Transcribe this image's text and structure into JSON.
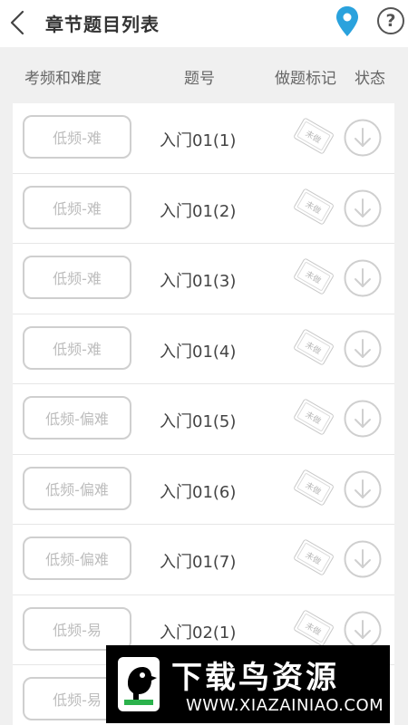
{
  "header": {
    "title": "章节题目列表",
    "back_icon": "back-chevron-icon",
    "location_icon": "location-pin-icon",
    "help_label": "?"
  },
  "columns": {
    "frequency_difficulty": "考频和难度",
    "question_number": "题号",
    "mark": "做题标记",
    "status": "状态"
  },
  "rows": [
    {
      "badge": "低频-难",
      "label": "入门01(1)",
      "mark": "未做"
    },
    {
      "badge": "低频-难",
      "label": "入门01(2)",
      "mark": "未做"
    },
    {
      "badge": "低频-难",
      "label": "入门01(3)",
      "mark": "未做"
    },
    {
      "badge": "低频-难",
      "label": "入门01(4)",
      "mark": "未做"
    },
    {
      "badge": "低频-偏难",
      "label": "入门01(5)",
      "mark": "未做"
    },
    {
      "badge": "低频-偏难",
      "label": "入门01(6)",
      "mark": "未做"
    },
    {
      "badge": "低频-偏难",
      "label": "入门01(7)",
      "mark": "未做"
    },
    {
      "badge": "低频-易",
      "label": "入门02(1)",
      "mark": "未做"
    },
    {
      "badge": "低频-易",
      "label": "",
      "mark": ""
    }
  ],
  "watermark": {
    "title": "下载鸟资源",
    "url": "WWW.XIAZAINIAO.COM"
  },
  "colors": {
    "accent_blue": "#2aa2dd",
    "badge_border": "#cfcfcf",
    "background": "#f0f0f0"
  }
}
